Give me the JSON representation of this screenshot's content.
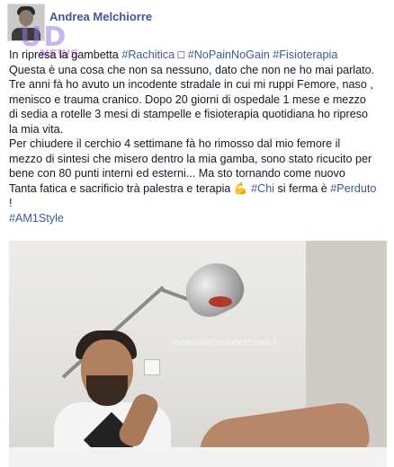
{
  "post": {
    "author_name": "Andrea Melchiorre",
    "watermark": {
      "top": "UD",
      "bottom": "NEWS"
    },
    "lines": [
      [
        {
          "t": "In ripresa la gambetta ",
          "link": false
        },
        {
          "t": "#Rachitica",
          "link": true
        },
        {
          "t": " □ ",
          "link": false
        },
        {
          "t": "#NoPainNoGain",
          "link": true
        },
        {
          "t": " ",
          "link": false
        },
        {
          "t": "#Fisioterapia",
          "link": true
        }
      ],
      [
        {
          "t": "Questa è una cosa che non sa nessuno, dato che non ne ho mai parlato.",
          "link": false
        }
      ],
      [
        {
          "t": "Tre anni fà ho avuto un incodente stradale in cui mi ruppi Femore, naso ,",
          "link": false
        }
      ],
      [
        {
          "t": "menisco e trauma cranico. Dopo 20 giorni di ospedale 1 mese e mezzo",
          "link": false
        }
      ],
      [
        {
          "t": "di sedia a rotelle 3 mesi di stampelle e fisioterapia quotidiana ho ripreso",
          "link": false
        }
      ],
      [
        {
          "t": "la mia vita.",
          "link": false
        }
      ],
      [
        {
          "t": "Per chiudere il cerchio 4 settimane fà ho rimosso dal mio femore il",
          "link": false
        }
      ],
      [
        {
          "t": "mezzo di sintesi che misero dentro la mia gamba, sono stato ricucito per",
          "link": false
        }
      ],
      [
        {
          "t": "bene con 80 punti interni ed esterni... Ma sto tornando come nuovo",
          "link": false
        }
      ],
      [
        {
          "t": "Tanta fatica e sacrificio trà palestra e terapia ",
          "link": false
        },
        {
          "t": "💪 ",
          "link": false
        },
        {
          "t": "#Chi",
          "link": true
        },
        {
          "t": " si ferma è ",
          "link": false
        },
        {
          "t": "#Perduto",
          "link": true
        }
      ],
      [
        {
          "t": "!",
          "link": false
        }
      ],
      [
        {
          "t": "#AM1Style",
          "link": true
        }
      ]
    ],
    "photo_watermark": "www.uominiedonnenews.it"
  },
  "colors": {
    "link": "#3b5998",
    "text": "#141823"
  }
}
